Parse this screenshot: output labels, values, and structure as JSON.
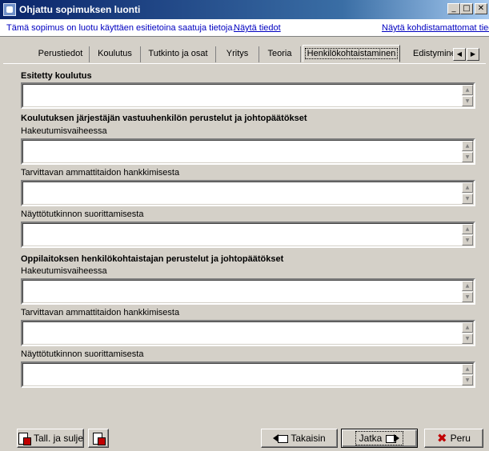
{
  "window": {
    "title": "Ohjattu sopimuksen luonti",
    "min_glyph": "_",
    "max_glyph": "□",
    "close_glyph": "✕"
  },
  "infobar": {
    "message": "Tämä sopimus on luotu käyttäen esitietoina saatuja tietoja.",
    "show_details_link": "Näytä tiedot",
    "show_unassigned_link": "Näytä kohdistamattomat tiedot"
  },
  "tabs": [
    {
      "label": "Perustiedot"
    },
    {
      "label": "Koulutus"
    },
    {
      "label": "Tutkinto ja osat"
    },
    {
      "label": "Yritys"
    },
    {
      "label": "Teoria"
    },
    {
      "label": "Henkilökohtaistaminen",
      "active": true
    },
    {
      "label": "Edistymine"
    }
  ],
  "tab_scroll": {
    "left": "◀",
    "right": "▶"
  },
  "form": {
    "section1_heading": "Esitetty koulutus",
    "section2_heading": "Koulutuksen järjestäjän vastuuhenkilön perustelut ja johtopäätökset",
    "section3_heading": "Oppilaitoksen henkilökohtaistajan perustelut ja johtopäätökset",
    "label_application": "Hakeutumisvaiheessa",
    "label_skills": "Tarvittavan ammattitaidon hankkimisesta",
    "label_demo": "Näyttötutkinnon suorittamisesta",
    "scroll_up": "▲",
    "scroll_down": "▼"
  },
  "buttons": {
    "save_close": "Tall. ja sulje",
    "back": "Takaisin",
    "next": "Jatka",
    "cancel": "Peru"
  },
  "icons": {
    "save": "save-icon",
    "back": "back-hand-icon",
    "next": "forward-hand-icon",
    "cancel": "red-x-icon"
  },
  "colors": {
    "title_bar": "#0a246a",
    "link": "#0000c0",
    "cancel_icon": "#c00000"
  }
}
